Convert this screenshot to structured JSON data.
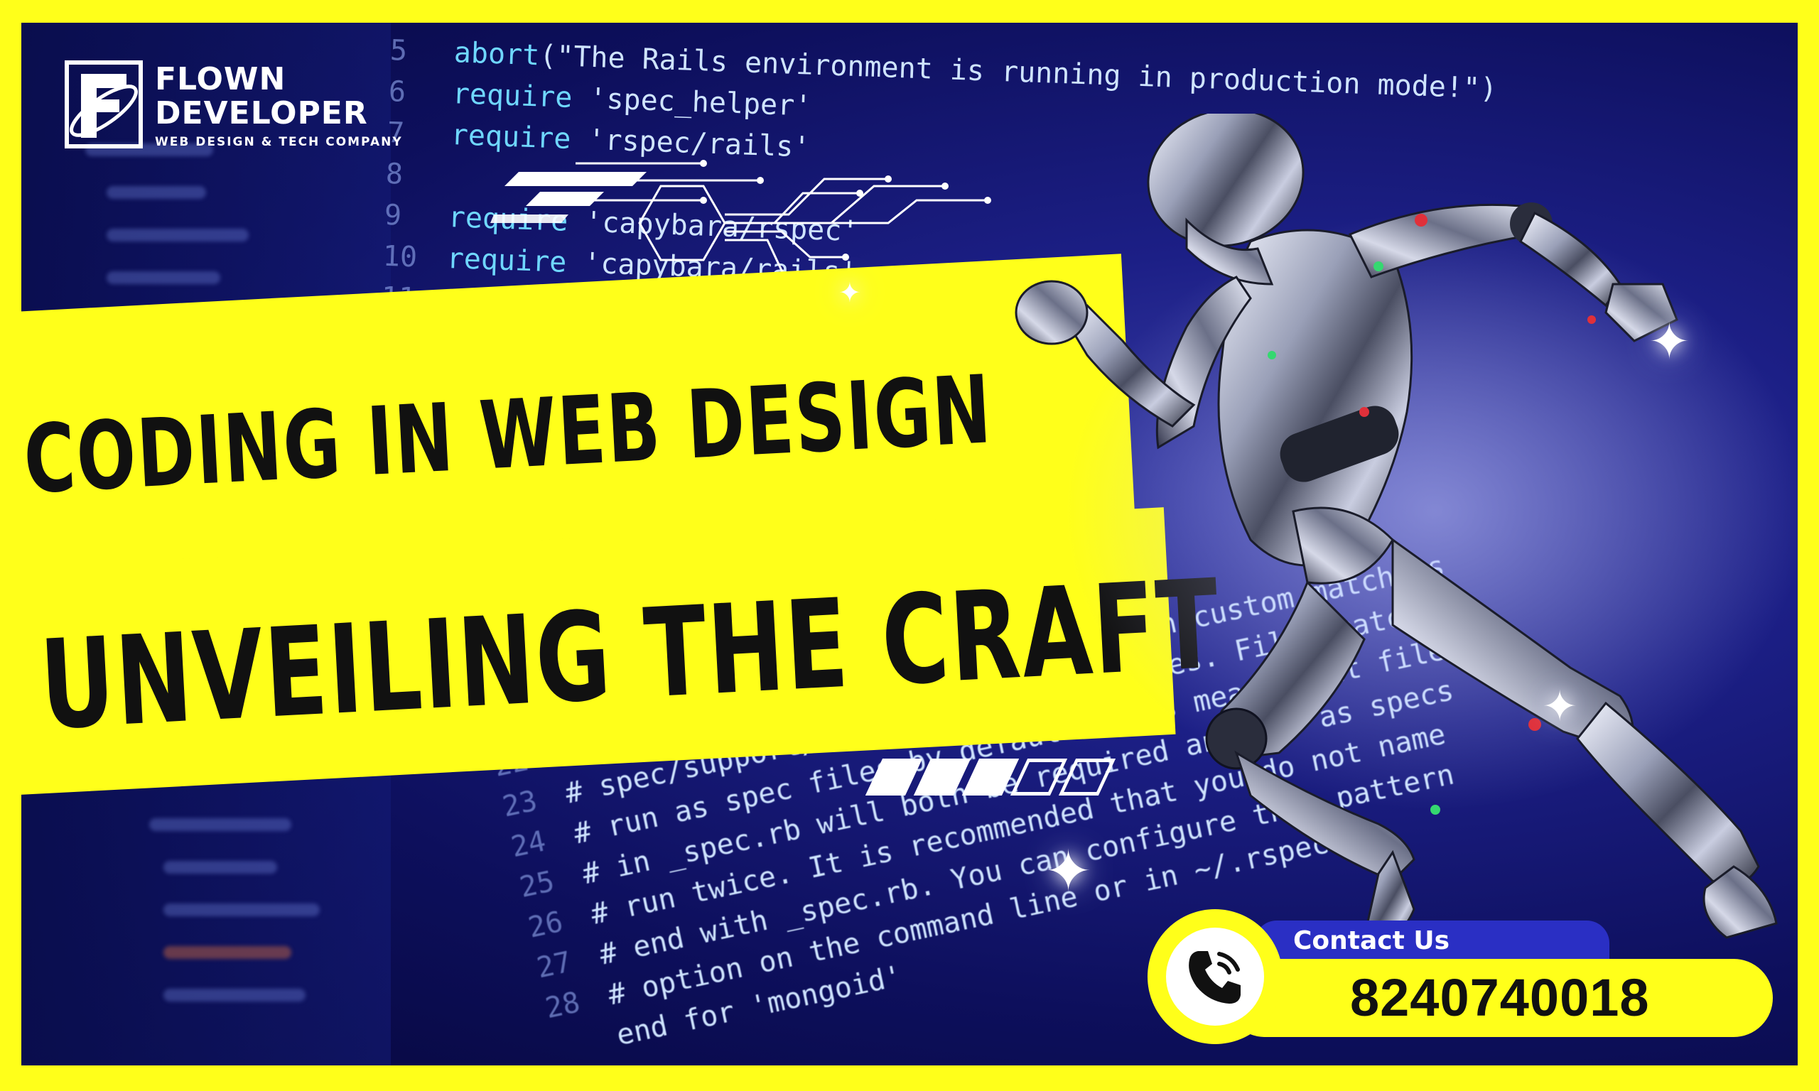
{
  "brand": {
    "name_line1": "FLOWN",
    "name_line2": "DEVELOPER",
    "tagline": "WEB DESIGN & TECH COMPANY"
  },
  "headline": {
    "line1": "CODING IN WEB DESIGN",
    "line2": "UNVEILING THE CRAFT"
  },
  "code_top": [
    {
      "ln": "5",
      "kw": "abort",
      "text": "(\"The Rails environment is running in production mode!\")"
    },
    {
      "ln": "6",
      "kw": "require",
      "text": " 'spec_helper'"
    },
    {
      "ln": "7",
      "kw": "require",
      "text": " 'rspec/rails'"
    },
    {
      "ln": "8",
      "kw": "",
      "text": ""
    },
    {
      "ln": "9",
      "kw": "require",
      "text": " 'capybara/rspec'"
    },
    {
      "ln": "10",
      "kw": "require",
      "text": " 'capybara/rails'"
    },
    {
      "ln": "11",
      "kw": "",
      "text": ""
    }
  ],
  "code_bottom": [
    {
      "ln": "22",
      "text": "# Requires supporting ruby files with custom matchers"
    },
    {
      "ln": "23",
      "text": "# spec/support/ and its subdirectories. Files matching"
    },
    {
      "ln": "24",
      "text": "# run as spec files by default. This means that files"
    },
    {
      "ln": "25",
      "text": "# in _spec.rb will both be required and run as specs"
    },
    {
      "ln": "26",
      "text": "# run twice. It is recommended that you do not name"
    },
    {
      "ln": "27",
      "text": "# end with _spec.rb. You can configure this pattern"
    },
    {
      "ln": "28",
      "text": "# option on the command line or in ~/.rspec"
    },
    {
      "ln": "",
      "text": "end for 'mongoid'"
    }
  ],
  "progress": {
    "filled": 3,
    "total": 5
  },
  "contact": {
    "label": "Contact Us",
    "phone": "8240740018"
  },
  "colors": {
    "accent_yellow": "#ffff1a",
    "navy": "#0d0f5c",
    "contact_blue": "#2a2fc4"
  }
}
